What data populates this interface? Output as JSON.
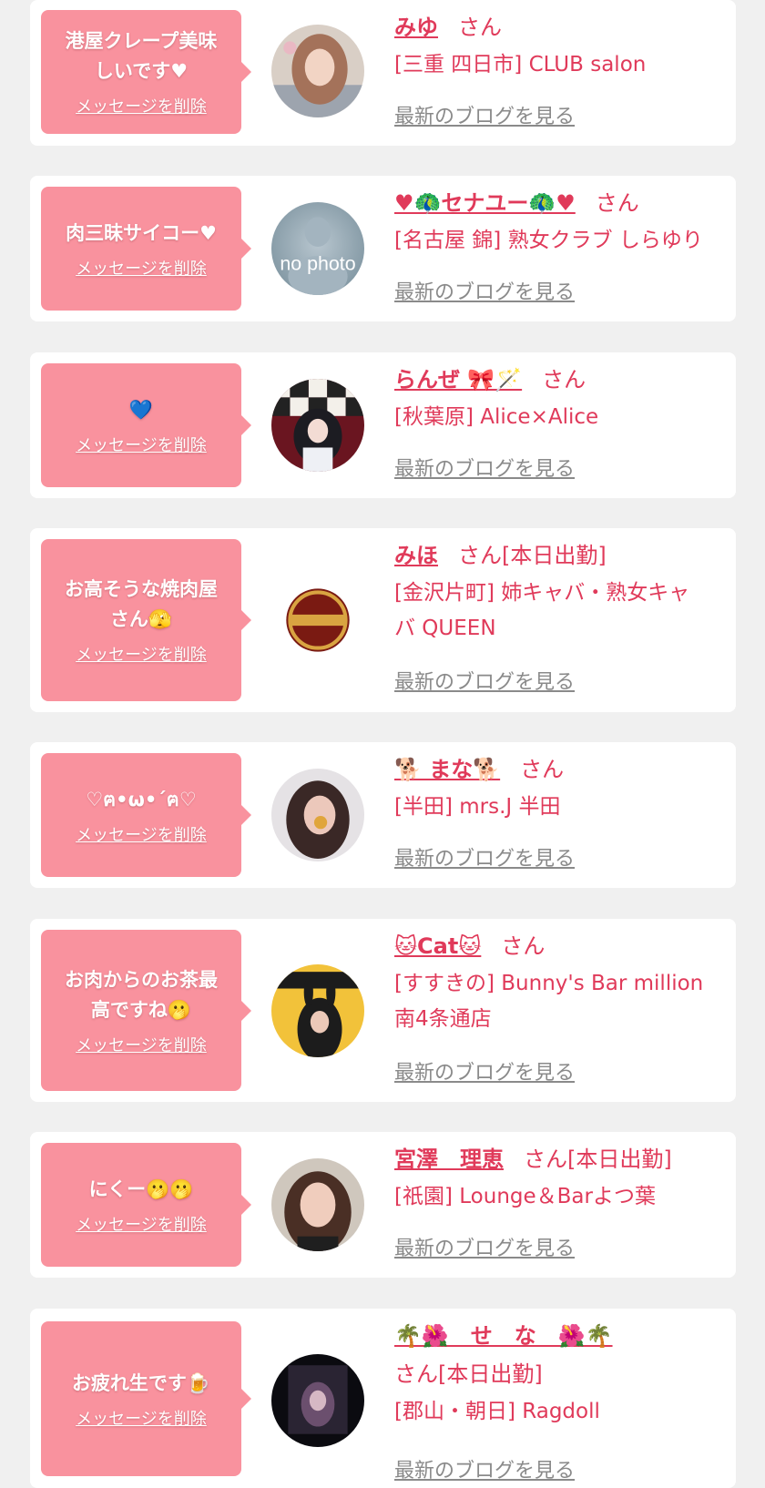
{
  "san_label": "さん",
  "delete_label": "メッセージを削除",
  "blog_label": "最新のブログを見る",
  "avatar_placeholder_text": "no photo",
  "entries": [
    {
      "message_line1": "港屋クレープ美味",
      "message_line2": "しいです♥",
      "name": "みゆ",
      "suffix": "",
      "shop": "[三重 四日市] CLUB salon",
      "shop_line2": ""
    },
    {
      "message_line1": "肉三昧サイコー♥",
      "message_line2": "",
      "name": "♥🦚セナユー🦚♥",
      "suffix": "",
      "shop": "[名古屋 錦] 熟女クラブ しらゆり",
      "shop_line2": ""
    },
    {
      "message_line1": "💙",
      "message_line2": "",
      "name": "らんぜ 🎀🪄",
      "suffix": "",
      "shop": "[秋葉原] Alice×Alice",
      "shop_line2": ""
    },
    {
      "message_line1": "お高そうな焼肉屋",
      "message_line2": "さん🫣",
      "name": "みほ",
      "suffix": "[本日出勤]",
      "shop": "[金沢片町] 姉キャバ・熟女キャ",
      "shop_line2": "バ QUEEN"
    },
    {
      "message_line1": "♡ฅ•ω•´ฅ♡",
      "message_line2": "",
      "name": "🐕 まな🐕",
      "suffix": "",
      "shop": "[半田] mrs.J 半田",
      "shop_line2": ""
    },
    {
      "message_line1": "お肉からのお茶最",
      "message_line2": "高ですね🫢",
      "name": "🐱Cat🐱",
      "suffix": "",
      "shop": "[すすきの] Bunny's Bar million",
      "shop_line2": "南4条通店"
    },
    {
      "message_line1": "にくー🫢🫢",
      "message_line2": "",
      "name": "宮澤　理恵",
      "suffix": "[本日出勤]",
      "shop": "[祇園] Lounge＆Barよつ葉",
      "shop_line2": ""
    },
    {
      "message_line1": "お疲れ生です🍺",
      "message_line2": "",
      "name": "🌴🌺　せ　な　🌺🌴",
      "suffix": "[本日出勤]",
      "shop": "[郡山・朝日] Ragdoll",
      "shop_line2": ""
    }
  ]
}
